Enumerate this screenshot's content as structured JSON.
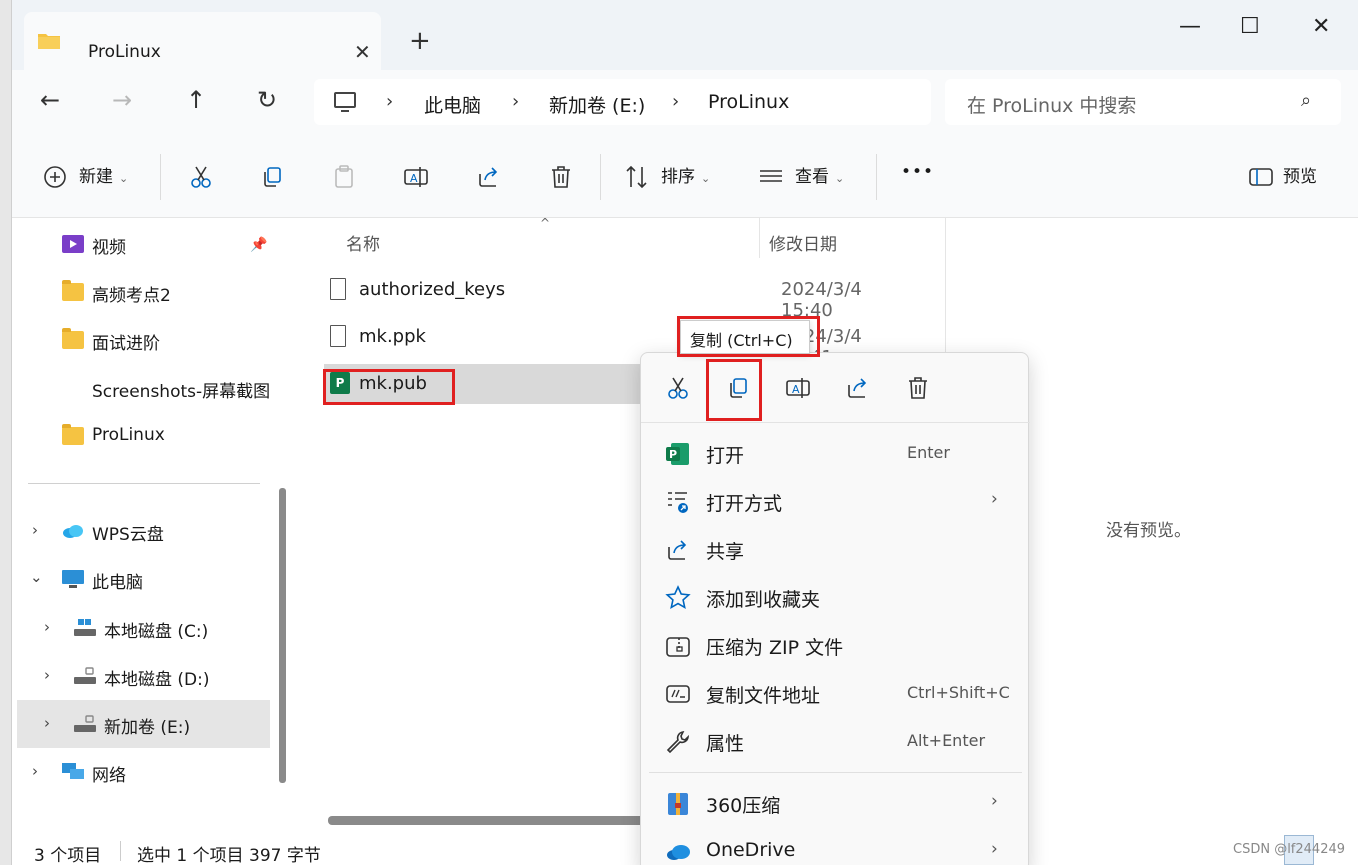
{
  "window": {
    "tab_title": "ProLinux",
    "close_tab": "✕",
    "new_tab": "+",
    "minimize": "—",
    "maximize": "☐",
    "close": "✕"
  },
  "nav": {
    "back": "←",
    "forward": "→",
    "up": "↑",
    "refresh": "↻",
    "breadcrumb": [
      "此电脑",
      "新加卷 (E:)",
      "ProLinux"
    ],
    "chevron": "›",
    "search_placeholder": "在 ProLinux 中搜索",
    "search_icon": "⌕"
  },
  "commands": {
    "new_label": "新建",
    "sort_label": "排序",
    "view_label": "查看",
    "more_label": "•••",
    "preview_label": "预览",
    "dropdown": "⌄"
  },
  "sidebar": {
    "items": [
      {
        "label": "视频",
        "icon": "video-icon",
        "pinned": true
      },
      {
        "label": "高频考点2",
        "icon": "folder-icon"
      },
      {
        "label": "面试进阶",
        "icon": "folder-icon"
      },
      {
        "label": "Screenshots-屏幕截图",
        "icon": "folder-icon"
      },
      {
        "label": "ProLinux",
        "icon": "folder-icon"
      },
      {
        "label": "WPS云盘",
        "icon": "cloud-icon"
      },
      {
        "label": "此电脑",
        "icon": "pc-icon"
      },
      {
        "label": "本地磁盘 (C:)",
        "icon": "drive-icon"
      },
      {
        "label": "本地磁盘 (D:)",
        "icon": "drive-icon"
      },
      {
        "label": "新加卷 (E:)",
        "icon": "drive-icon",
        "selected": true
      },
      {
        "label": "网络",
        "icon": "network-icon"
      }
    ],
    "pin": "📌",
    "expand": "›",
    "collapse": "⌄"
  },
  "files": {
    "col_name": "名称",
    "col_date": "修改日期",
    "sort_arrow": "^",
    "rows": [
      {
        "name": "authorized_keys",
        "date": "2024/3/4 15:40"
      },
      {
        "name": "mk.ppk",
        "date": "2024/3/4 15:41"
      },
      {
        "name": "mk.pub",
        "date": "",
        "selected": true
      }
    ]
  },
  "preview": {
    "message": "没有预览。"
  },
  "status": {
    "count": "3 个项目",
    "selection": "选中 1 个项目  397 字节"
  },
  "context_menu": {
    "tooltip": "复制 (Ctrl+C)",
    "items": [
      {
        "label": "打开",
        "key": "Enter",
        "icon": "publisher-icon"
      },
      {
        "label": "打开方式",
        "key": "",
        "arrow": "›",
        "icon": "open-with-icon"
      },
      {
        "label": "共享",
        "key": "",
        "icon": "share-icon"
      },
      {
        "label": "添加到收藏夹",
        "key": "",
        "icon": "star-icon"
      },
      {
        "label": "压缩为 ZIP 文件",
        "key": "",
        "icon": "zip-icon"
      },
      {
        "label": "复制文件地址",
        "key": "Ctrl+Shift+C",
        "icon": "path-icon"
      },
      {
        "label": "属性",
        "key": "Alt+Enter",
        "icon": "wrench-icon"
      },
      {
        "label": "360压缩",
        "key": "",
        "arrow": "›",
        "icon": "compress360-icon"
      },
      {
        "label": "OneDrive",
        "key": "",
        "arrow": "›",
        "icon": "onedrive-icon"
      }
    ]
  },
  "watermark": "CSDN @lf244249",
  "colors": {
    "highlight": "#e02020",
    "selected_row": "#d9d9d9",
    "accent": "#0067c0"
  }
}
